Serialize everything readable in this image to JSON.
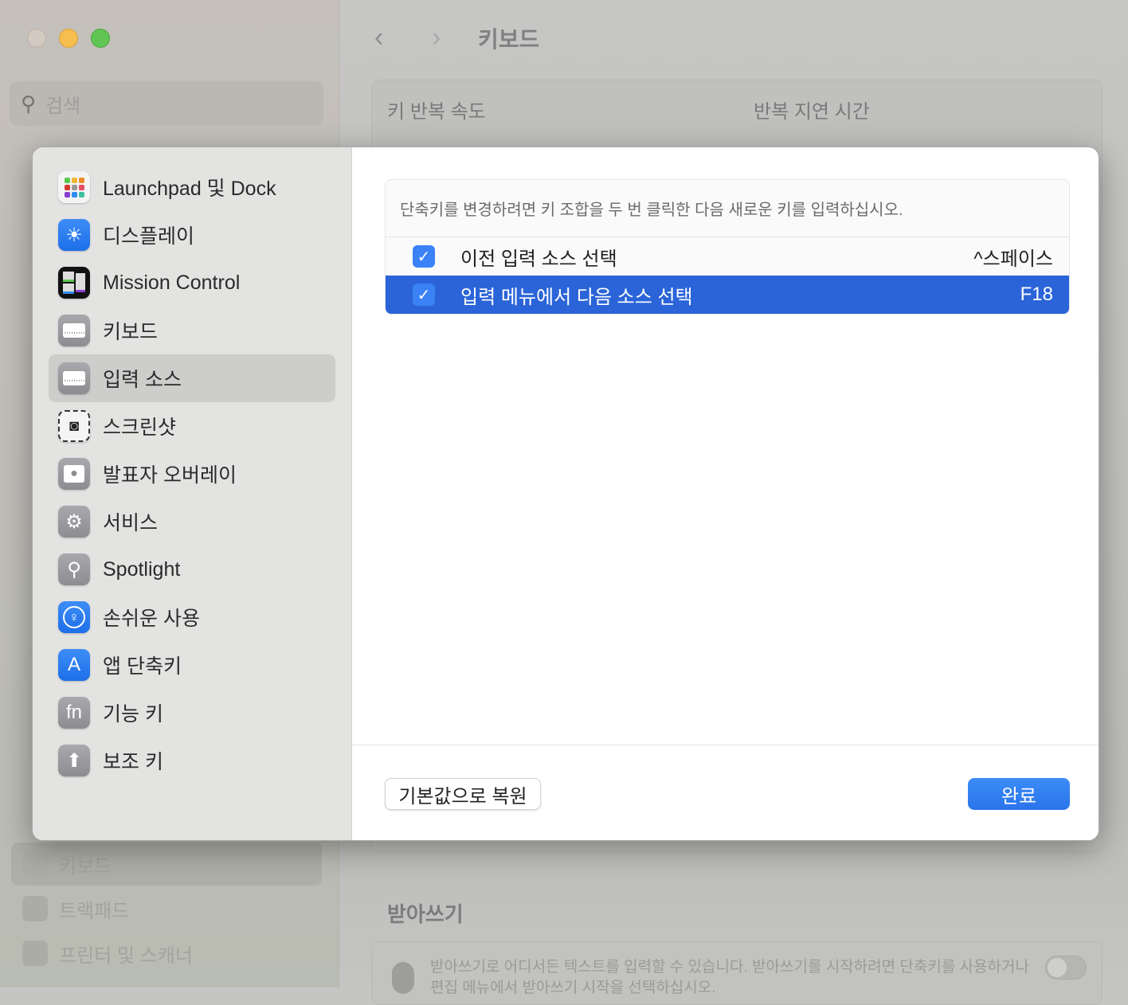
{
  "window": {
    "traffic_lights": {
      "close": "#d2c9c0",
      "minimize": "#f6be4f",
      "zoom": "#61c554"
    },
    "search_placeholder": "검색",
    "title": "키보드",
    "section_labels": {
      "key_repeat": "키 반복 속도",
      "repeat_delay": "반복 지연 시간"
    },
    "background_sidebar": [
      {
        "label": "키보드",
        "icon": "keyboard-icon"
      },
      {
        "label": "트랙패드",
        "icon": "trackpad-icon"
      },
      {
        "label": "프린터 및 스캐너",
        "icon": "printer-icon"
      }
    ],
    "dictation": {
      "title": "받아쓰기",
      "description": "받아쓰기로 어디서든 텍스트를 입력할 수 있습니다. 받아쓰기를 시작하려면 단축키를 사용하거나 편집 메뉴에서 받아쓰기 시작을 선택하십시오.",
      "enabled": false
    }
  },
  "sheet": {
    "sidebar": [
      {
        "label": "Launchpad 및 Dock",
        "icon": "launchpad-icon"
      },
      {
        "label": "디스플레이",
        "icon": "display-icon"
      },
      {
        "label": "Mission Control",
        "icon": "mission-control-icon"
      },
      {
        "label": "키보드",
        "icon": "keyboard-icon"
      },
      {
        "label": "입력 소스",
        "icon": "keyboard-icon",
        "selected": true
      },
      {
        "label": "스크린샷",
        "icon": "screenshot-icon"
      },
      {
        "label": "발표자 오버레이",
        "icon": "presenter-overlay-icon"
      },
      {
        "label": "서비스",
        "icon": "gears-icon"
      },
      {
        "label": "Spotlight",
        "icon": "spotlight-icon"
      },
      {
        "label": "손쉬운 사용",
        "icon": "accessibility-icon"
      },
      {
        "label": "앱 단축키",
        "icon": "app-store-icon"
      },
      {
        "label": "기능 키",
        "icon": "fn-icon",
        "glyph": "fn"
      },
      {
        "label": "보조 키",
        "icon": "shift-arrow-icon"
      }
    ],
    "hint": "단축키를 변경하려면 키 조합을 두 번 클릭한 다음 새로운 키를 입력하십시오.",
    "shortcuts": [
      {
        "label": "이전 입력 소스 선택",
        "shortcut": "^스페이스",
        "checked": true,
        "selected": false
      },
      {
        "label": "입력 메뉴에서 다음 소스 선택",
        "shortcut": "F18",
        "checked": true,
        "selected": true
      }
    ],
    "restore_label": "기본값으로 복원",
    "done_label": "완료",
    "accent": "#2a64d8"
  }
}
